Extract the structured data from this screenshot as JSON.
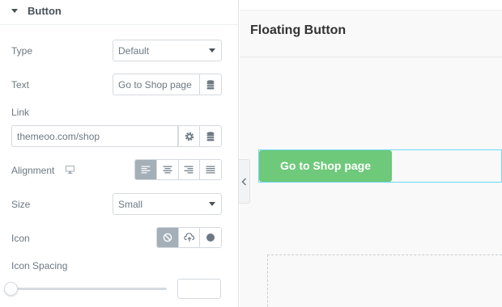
{
  "panel": {
    "section_title": "Button",
    "type": {
      "label": "Type",
      "value": "Default"
    },
    "text": {
      "label": "Text",
      "value": "Go to Shop page"
    },
    "link": {
      "label": "Link",
      "value": "themeoo.com/shop"
    },
    "alignment": {
      "label": "Alignment",
      "options": [
        "align-left-icon",
        "align-center-icon",
        "align-right-icon",
        "align-justify-icon"
      ],
      "selected": "align-left-icon"
    },
    "size": {
      "label": "Size",
      "value": "Small"
    },
    "icon": {
      "label": "Icon",
      "options": [
        "ban-icon",
        "upload-icon",
        "circle-icon"
      ],
      "selected": "ban-icon"
    },
    "icon_spacing": {
      "label": "Icon Spacing",
      "value": ""
    }
  },
  "preview": {
    "page_title": "Floating Button",
    "button_label": "Go to Shop page",
    "button_color": "#6ec97a",
    "selection_color": "#71d7f7"
  },
  "colors": {
    "active_choice": "#a4afb7",
    "label_text": "#6d7882"
  }
}
